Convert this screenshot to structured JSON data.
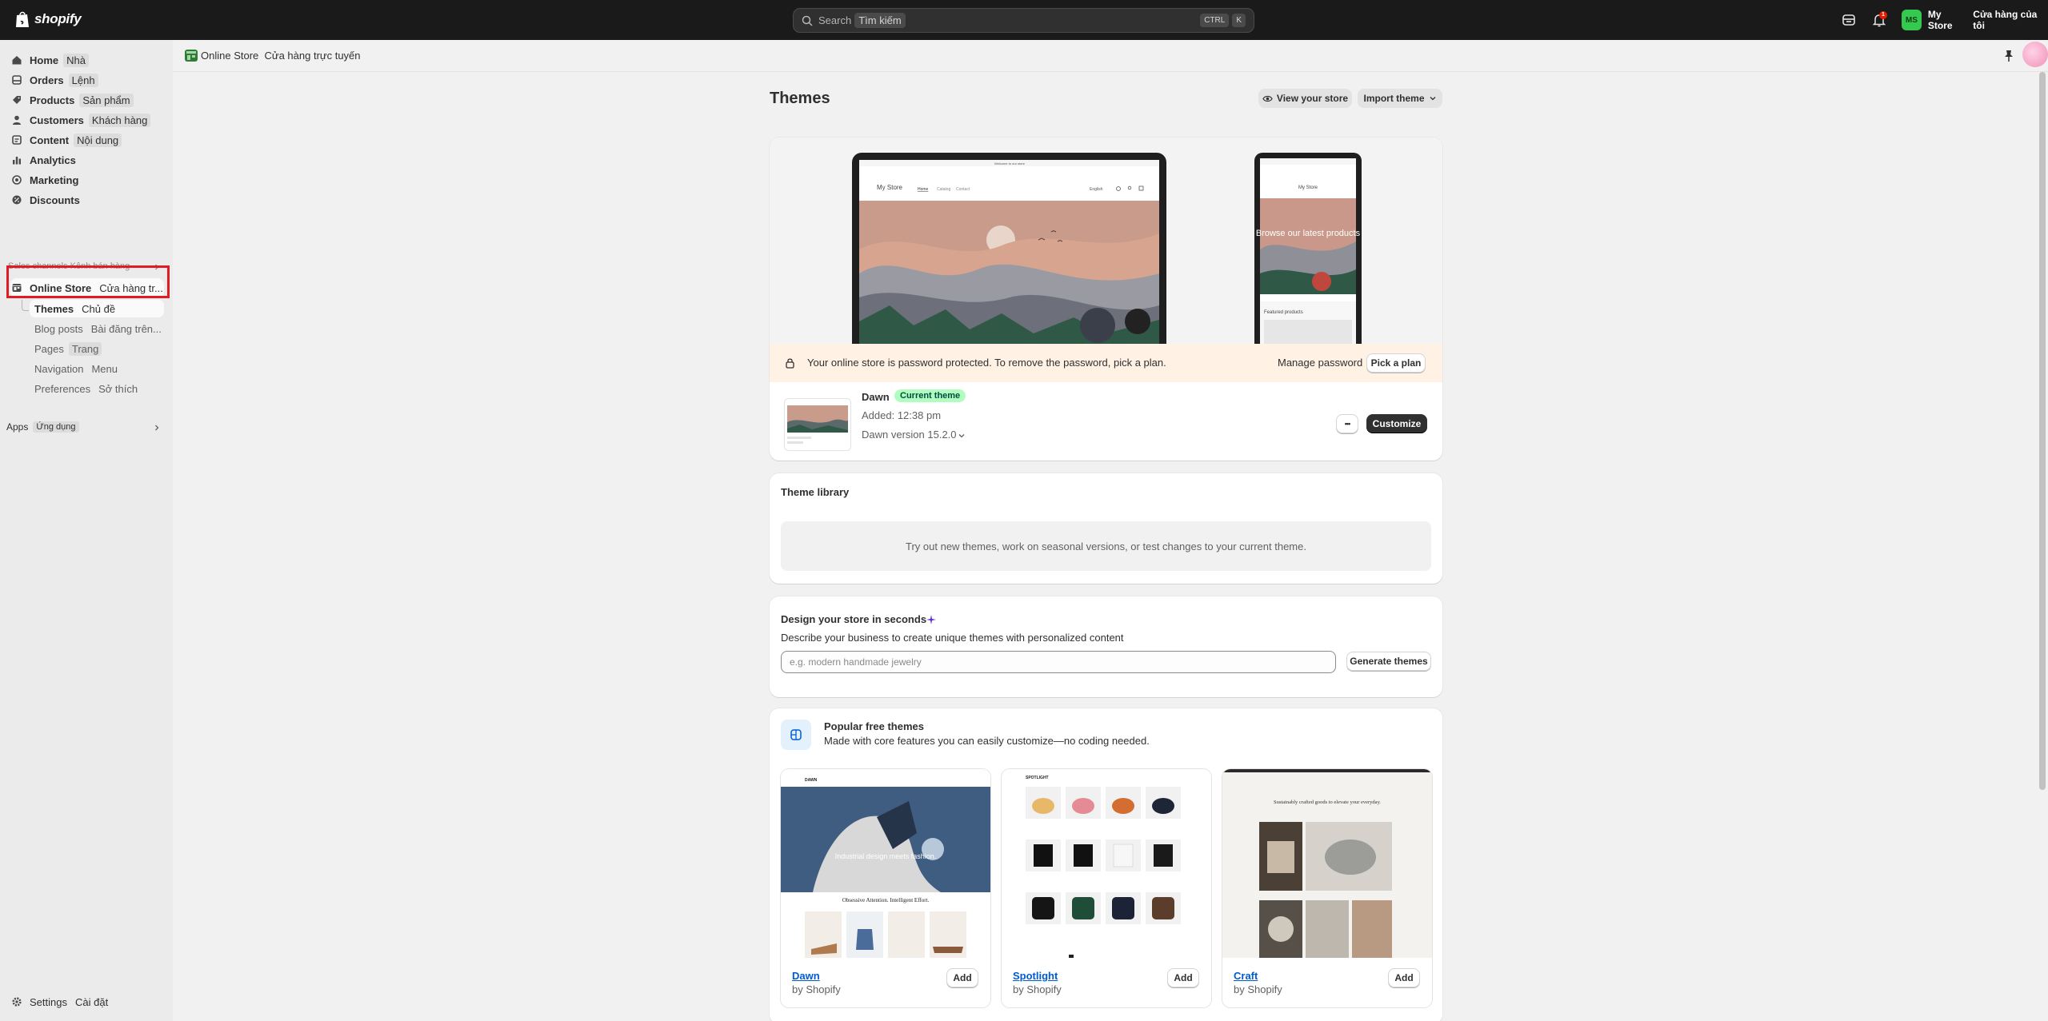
{
  "topbar": {
    "logo_text": "shopify",
    "search_label": "Search",
    "search_translation": "Tìm kiếm",
    "shortcut_keys": [
      "CTRL",
      "K"
    ],
    "notification_count": "1",
    "avatar_initials": "MS",
    "store_name": "My Store",
    "store_name_translation": "Cửa hàng của tôi"
  },
  "sidebar": {
    "items": [
      {
        "label": "Home",
        "translation": "Nhà",
        "icon": "home-icon"
      },
      {
        "label": "Orders",
        "translation": "Lệnh",
        "icon": "orders-icon"
      },
      {
        "label": "Products",
        "translation": "Sản phẩm",
        "icon": "tag-icon"
      },
      {
        "label": "Customers",
        "translation": "Khách hàng",
        "icon": "person-icon"
      },
      {
        "label": "Content",
        "translation": "Nội dung",
        "icon": "content-icon"
      },
      {
        "label": "Analytics",
        "translation": "",
        "icon": "chart-icon"
      },
      {
        "label": "Marketing",
        "translation": "",
        "icon": "target-icon"
      },
      {
        "label": "Discounts",
        "translation": "",
        "icon": "discount-icon"
      }
    ],
    "sales_channels_label": "Sales channels  Kênh bán hàng",
    "online_store": {
      "label": "Online Store",
      "translation": "Cửa hàng tr..."
    },
    "sub_items": [
      {
        "label": "Themes",
        "translation": "Chủ đề"
      },
      {
        "label": "Blog posts",
        "translation": "Bài đăng trên..."
      },
      {
        "label": "Pages",
        "translation": "Trang"
      },
      {
        "label": "Navigation",
        "translation": "Menu"
      },
      {
        "label": "Preferences",
        "translation": "Sở thích"
      }
    ],
    "apps": {
      "label": "Apps",
      "translation": "Ứng dụng"
    },
    "settings": {
      "label": "Settings",
      "translation": "Cài đặt"
    }
  },
  "subheader": {
    "crumb": "Online Store",
    "crumb_translation": "Cửa hàng trực tuyến"
  },
  "page": {
    "title": "Themes",
    "view_store": "View your store",
    "import_theme": "Import theme"
  },
  "preview": {
    "announcement": "Welcome to our store",
    "desktop_store": "My Store",
    "nav": [
      "Home",
      "Catalog",
      "Contact"
    ],
    "language": "English",
    "mobile_store": "My Store",
    "mobile_headline": "Browse our latest products",
    "mobile_featured": "Featured products"
  },
  "banner": {
    "text": "Your online store is password protected. To remove the password, pick a plan.",
    "manage_password": "Manage password",
    "pick_plan": "Pick a plan"
  },
  "current_theme": {
    "name": "Dawn",
    "badge": "Current theme",
    "added": "Added: 12:38 pm",
    "version": "Dawn version 15.2.0",
    "more": "•••",
    "customize": "Customize"
  },
  "library": {
    "title": "Theme library",
    "empty_text": "Try out new themes, work on seasonal versions, or test changes to your current theme."
  },
  "design": {
    "title": "Design your store in seconds",
    "description": "Describe your business to create unique themes with personalized content",
    "placeholder": "e.g. modern handmade jewelry",
    "generate": "Generate themes"
  },
  "popular": {
    "title": "Popular free themes",
    "subtitle": "Made with core features you can easily customize—no coding needed.",
    "themes": [
      {
        "name": "Dawn",
        "by": "by Shopify",
        "add": "Add",
        "preview_text": "Industrial design meets fashion.",
        "preview_sub": "Obsessive Attention. Intelligent Effort."
      },
      {
        "name": "Spotlight",
        "by": "by Shopify",
        "add": "Add",
        "preview_text": "SPOTLIGHT"
      },
      {
        "name": "Craft",
        "by": "by Shopify",
        "add": "Add",
        "preview_text": "Sustainably crafted goods to elevate your everyday."
      }
    ]
  },
  "colors": {
    "topbar_bg": "#1a1a1a",
    "sidebar_bg": "#ebebeb",
    "page_bg": "#f1f1f1",
    "banner_bg": "#fff1e3",
    "badge_bg": "#affebf",
    "link": "#005bd3",
    "highlight_box": "#e01b24",
    "avatar_bg": "#36c94f"
  }
}
